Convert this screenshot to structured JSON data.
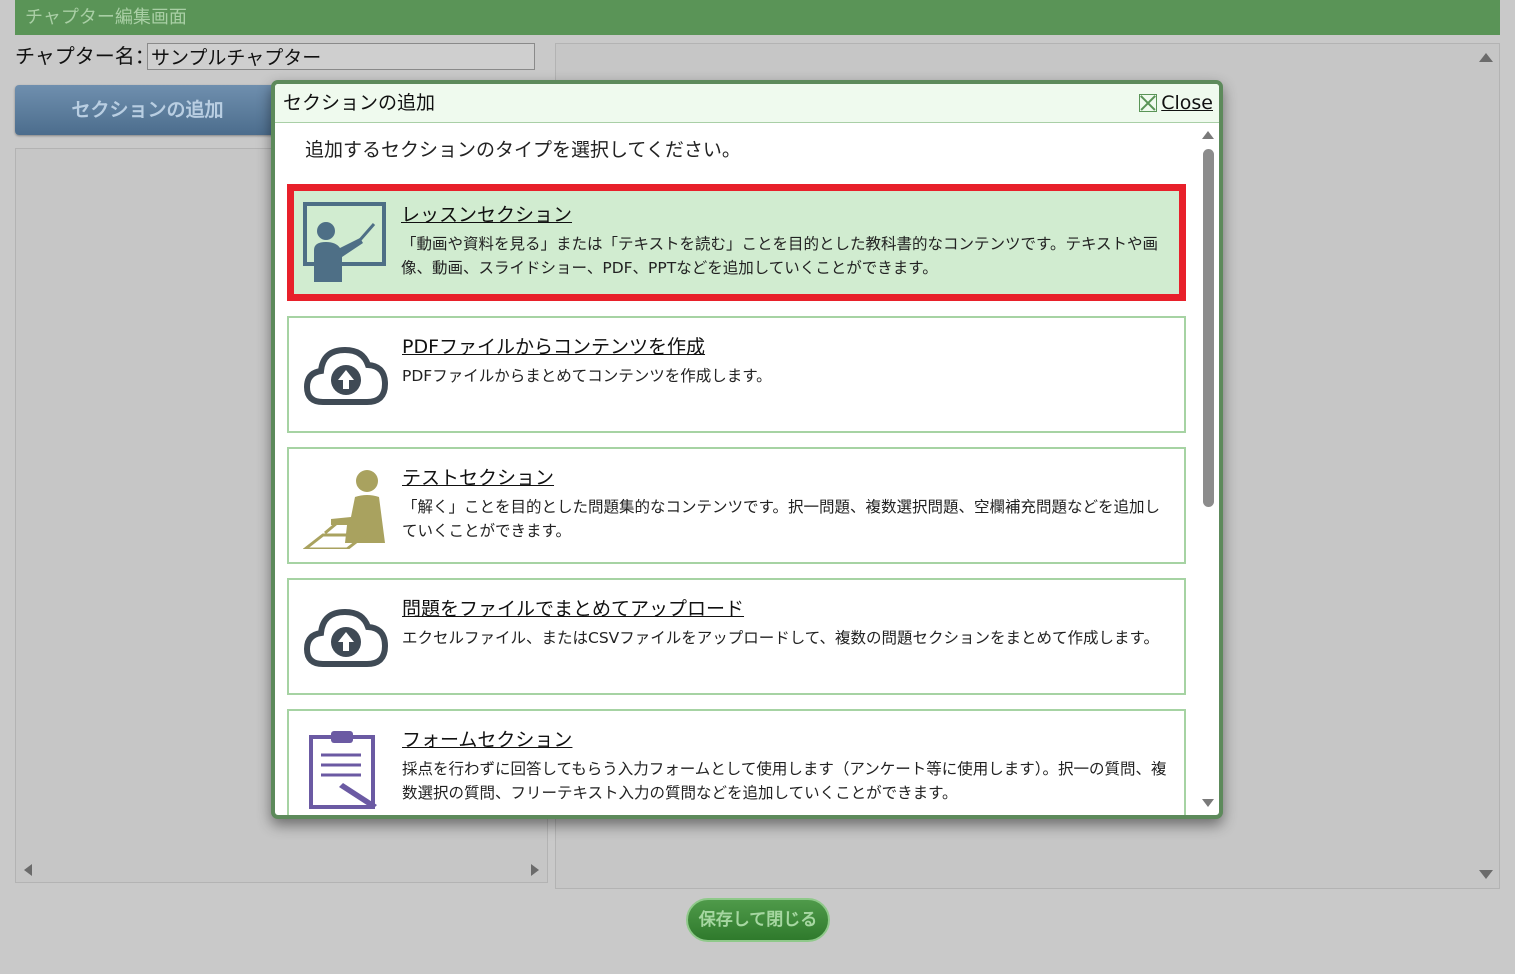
{
  "window": {
    "title": "チャプター編集画面"
  },
  "chapter": {
    "name_label": "チャプター名：",
    "name_value": "サンプルチャプター"
  },
  "buttons": {
    "add_section": "セクションの追加",
    "save_close": "保存して閉じる"
  },
  "modal": {
    "title": "セクションの追加",
    "close_label": "Close",
    "intro": "追加するセクションのタイプを選択してください。",
    "options": [
      {
        "title": "レッスンセクション",
        "icon": "teacher-board-icon",
        "selected": true,
        "desc": "「動画や資料を見る」または「テキストを読む」ことを目的とした教科書的なコンテンツです。テキストや画像、動画、スライドショー、PDF、PPTなどを追加していくことができます。"
      },
      {
        "title": "PDFファイルからコンテンツを作成",
        "icon": "cloud-upload-icon",
        "selected": false,
        "desc": "PDFファイルからまとめてコンテンツを作成します。"
      },
      {
        "title": "テストセクション",
        "icon": "person-writing-icon",
        "selected": false,
        "desc": "「解く」ことを目的とした問題集的なコンテンツです。択一問題、複数選択問題、空欄補充問題などを追加していくことができます。"
      },
      {
        "title": "問題をファイルでまとめてアップロード",
        "icon": "cloud-upload-icon",
        "selected": false,
        "desc": "エクセルファイル、またはCSVファイルをアップロードして、複数の問題セクションをまとめて作成します。"
      },
      {
        "title": "フォームセクション",
        "icon": "clipboard-pen-icon",
        "selected": false,
        "desc": "採点を行わずに回答してもらう入力フォームとして使用します（アンケート等に使用します）。択一の質問、複数選択の質問、フリーテキスト入力の質問などを追加していくことができます。"
      }
    ]
  },
  "colors": {
    "accent_green": "#5a9457",
    "selected_border": "#e8202a",
    "selected_bg": "#d1ecd0",
    "card_border": "#a6d3a3"
  }
}
